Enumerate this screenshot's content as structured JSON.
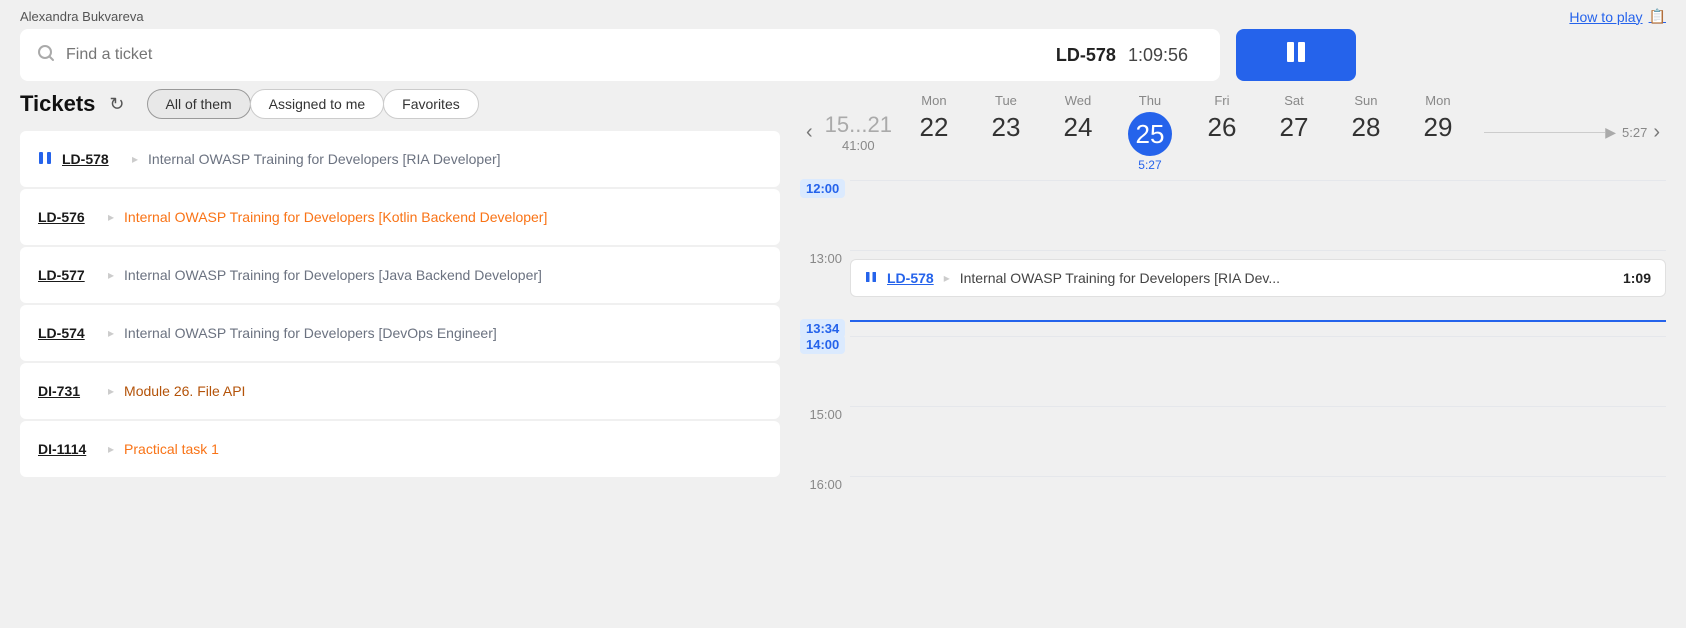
{
  "topBar": {
    "userName": "Alexandra Bukvareva",
    "howToPlay": "How to play",
    "bookIcon": "📋"
  },
  "search": {
    "placeholder": "Find a ticket",
    "currentTicketId": "LD-578",
    "timerValue": "1:09:56"
  },
  "pauseButton": {
    "label": "⏸"
  },
  "tickets": {
    "title": "Tickets",
    "refreshIcon": "↻",
    "filters": [
      {
        "label": "All of them",
        "active": true
      },
      {
        "label": "Assigned to me",
        "active": false
      },
      {
        "label": "Favorites",
        "active": false
      }
    ],
    "items": [
      {
        "id": "LD-578",
        "name": "Internal OWASP Training for Developers [RIA Developer]",
        "paused": true,
        "color": "blue-grey"
      },
      {
        "id": "LD-576",
        "name": "Internal OWASP Training for Developers [Kotlin Backend Developer]",
        "paused": false,
        "color": "orange"
      },
      {
        "id": "LD-577",
        "name": "Internal OWASP Training for Developers [Java Backend Developer]",
        "paused": false,
        "color": "blue-grey"
      },
      {
        "id": "LD-574",
        "name": "Internal OWASP Training for Developers [DevOps Engineer]",
        "paused": false,
        "color": "blue-grey"
      },
      {
        "id": "DI-731",
        "name": "Module 26. File API",
        "paused": false,
        "color": "gold"
      },
      {
        "id": "DI-1114",
        "name": "Practical task 1",
        "paused": false,
        "color": "orange"
      }
    ]
  },
  "calendar": {
    "days": [
      {
        "name": "",
        "num": "15...21",
        "sub": "",
        "range": true
      },
      {
        "name": "Mon",
        "num": "22",
        "sub": "",
        "today": false
      },
      {
        "name": "Tue",
        "num": "23",
        "sub": "",
        "today": false
      },
      {
        "name": "Wed",
        "num": "24",
        "sub": "",
        "today": false
      },
      {
        "name": "Thu",
        "num": "25",
        "sub": "5:27",
        "today": true
      },
      {
        "name": "Fri",
        "num": "26",
        "sub": "",
        "today": false
      },
      {
        "name": "Sat",
        "num": "27",
        "sub": "",
        "today": false
      },
      {
        "name": "Sun",
        "num": "28",
        "sub": "",
        "today": false
      },
      {
        "name": "Mon",
        "num": "29",
        "sub": "",
        "today": false
      }
    ],
    "totalLabel": "41:00",
    "timelineEndTime": "5:27",
    "timeSlots": [
      {
        "time": "12:00",
        "highlighted": true,
        "events": []
      },
      {
        "time": "13:00",
        "highlighted": false,
        "events": [
          {
            "id": "LD-578",
            "name": "Internal OWASP Training for Developers [RIA Dev...",
            "duration": "1:09",
            "paused": true
          }
        ]
      },
      {
        "time": "13:34",
        "highlighted": true,
        "currentLine": true,
        "events": []
      },
      {
        "time": "14:00",
        "highlighted": true,
        "events": []
      },
      {
        "time": "15:00",
        "highlighted": false,
        "events": []
      },
      {
        "time": "16:00",
        "highlighted": false,
        "events": []
      }
    ]
  }
}
